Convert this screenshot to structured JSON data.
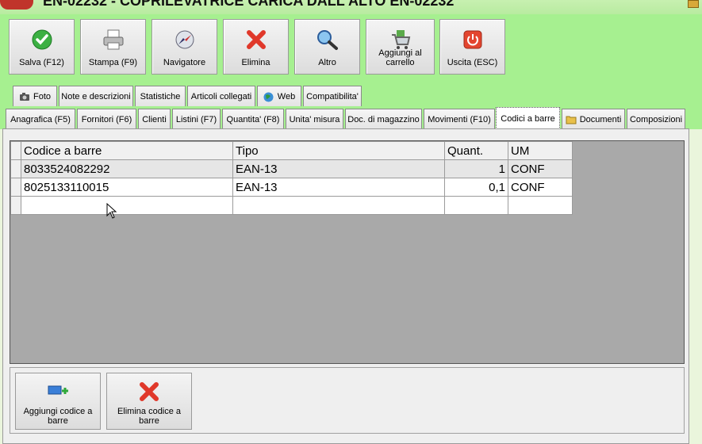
{
  "window": {
    "title": "EN-02232 - COPRILEVATRICE CARICA DALL'ALTO EN-02232"
  },
  "toolbar": {
    "buttons": [
      {
        "label": "Salva (F12)",
        "icon": "checkmark-icon"
      },
      {
        "label": "Stampa (F9)",
        "icon": "printer-icon"
      },
      {
        "label": "Navigatore",
        "icon": "compass-icon"
      },
      {
        "label": "Elimina",
        "icon": "red-x-icon"
      },
      {
        "label": "Altro",
        "icon": "magnifier-icon"
      },
      {
        "label": "Aggiungi al carrello",
        "icon": "cart-icon"
      },
      {
        "label": "Uscita (ESC)",
        "icon": "power-icon"
      }
    ]
  },
  "tabs_row1": [
    {
      "label": "Foto",
      "icon": "camera-icon"
    },
    {
      "label": "Note e descrizioni"
    },
    {
      "label": "Statistiche"
    },
    {
      "label": "Articoli collegati"
    },
    {
      "label": "Web",
      "icon": "globe-icon"
    },
    {
      "label": "Compatibilita'"
    }
  ],
  "tabs_row2": [
    {
      "label": "Anagrafica (F5)"
    },
    {
      "label": "Fornitori (F6)"
    },
    {
      "label": "Clienti"
    },
    {
      "label": "Listini (F7)"
    },
    {
      "label": "Quantita' (F8)"
    },
    {
      "label": "Unita' misura"
    },
    {
      "label": "Doc. di magazzino"
    },
    {
      "label": "Movimenti (F10)"
    },
    {
      "label": "Codici a barre",
      "active": true
    },
    {
      "label": "Documenti",
      "icon": "folder-icon"
    },
    {
      "label": "Composizioni"
    }
  ],
  "grid": {
    "columns": [
      "Codice a barre",
      "Tipo",
      "Quant.",
      "UM"
    ],
    "rows": [
      [
        "8033524082292",
        "EAN-13",
        "1",
        "CONF"
      ],
      [
        "8025133110015",
        "EAN-13",
        "0,1",
        "CONF"
      ],
      [
        "",
        "",
        "",
        ""
      ]
    ]
  },
  "bottom_buttons": [
    {
      "label": "Aggiungi codice a barre",
      "icon": "add-barcode-icon"
    },
    {
      "label": "Elimina codice a barre",
      "icon": "red-x-icon"
    }
  ],
  "colors": {
    "window_bg": "#a6f090",
    "grid_bg": "#a9a9a9",
    "delete_red": "#e0382a",
    "save_green": "#3cb043"
  }
}
